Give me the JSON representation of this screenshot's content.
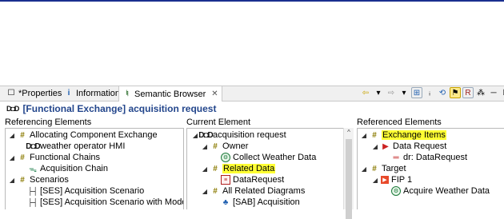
{
  "tabs": [
    {
      "label": "*Properties",
      "icon": "properties-icon"
    },
    {
      "label": "Information",
      "icon": "info-icon"
    },
    {
      "label": "Semantic Browser",
      "icon": "semantic-browser-icon",
      "close": "✕"
    }
  ],
  "title": "[Functional Exchange] acquisition request",
  "columns": {
    "referencing": {
      "header": "Referencing Elements",
      "rows": [
        {
          "label": "Allocating Component Exchange"
        },
        {
          "label": "weather operator HMI"
        },
        {
          "label": "Functional Chains"
        },
        {
          "label": "Acquisition Chain"
        },
        {
          "label": "Scenarios"
        },
        {
          "label": "[SES] Acquisition Scenario"
        },
        {
          "label": "[SES] Acquisition Scenario with Modes"
        }
      ]
    },
    "current": {
      "header": "Current Element",
      "rows": [
        {
          "label": "acquisition request"
        },
        {
          "label": "Owner"
        },
        {
          "label": "Collect Weather Data"
        },
        {
          "label": "Related Data"
        },
        {
          "label": "DataRequest"
        },
        {
          "label": "All Related Diagrams"
        },
        {
          "label": "[SAB] Acquisition"
        }
      ]
    },
    "referenced": {
      "header": "Referenced Elements",
      "rows": [
        {
          "label": "Exchange Items"
        },
        {
          "label": "Data Request"
        },
        {
          "label": "dr: DataRequest"
        },
        {
          "label": "Target"
        },
        {
          "label": "FIP 1"
        },
        {
          "label": "Acquire Weather Data"
        }
      ]
    }
  },
  "colors": {
    "title": "#23468c",
    "highlight": "#ffff33",
    "accent_bar": "#1a2f8f"
  }
}
